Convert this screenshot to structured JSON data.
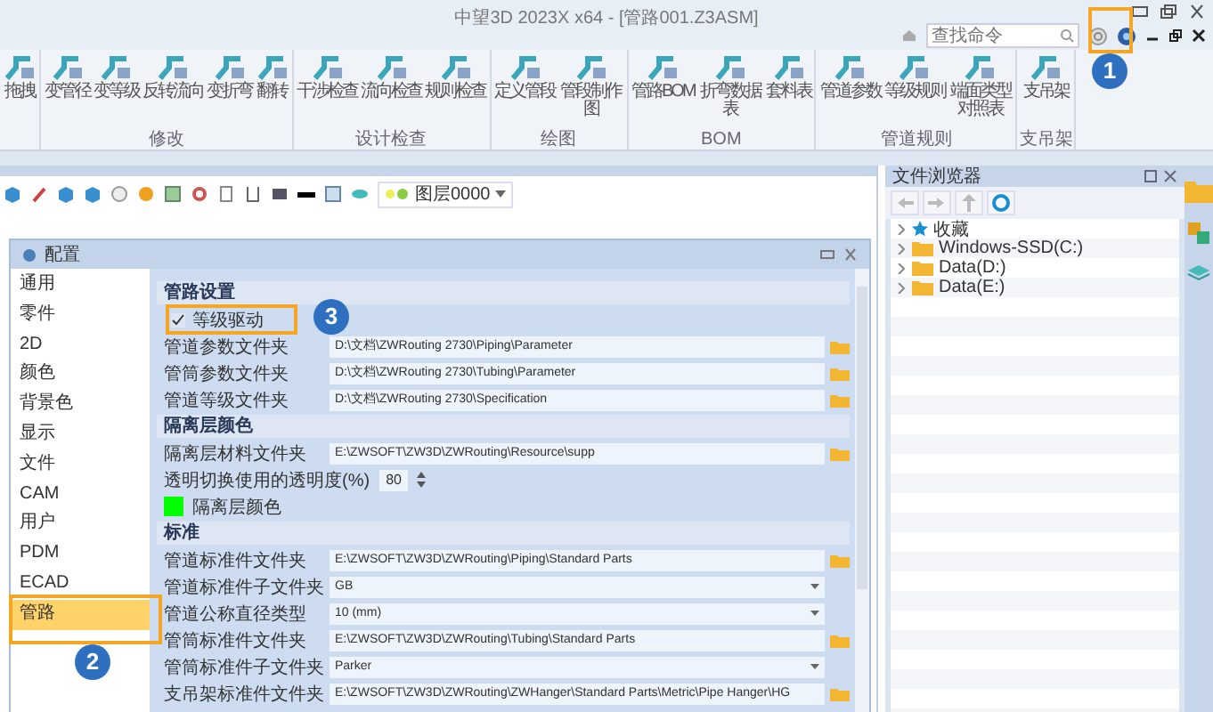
{
  "window": {
    "title": "中望3D 2023X x64 - [管路001.Z3ASM]"
  },
  "search": {
    "placeholder": "查找命令"
  },
  "ribbon": {
    "groups": [
      {
        "buttons": [
          {
            "label": "拖拽"
          }
        ]
      },
      {
        "label": "修改",
        "buttons": [
          {
            "label": "变管径"
          },
          {
            "label": "变等级"
          },
          {
            "label": "反转流向"
          },
          {
            "label": "变折弯"
          },
          {
            "label": "翻转"
          }
        ]
      },
      {
        "label": "设计检查",
        "buttons": [
          {
            "label": "干涉检查"
          },
          {
            "label": "流向检查"
          },
          {
            "label": "规则检查"
          }
        ]
      },
      {
        "label": "绘图",
        "buttons": [
          {
            "label": "定义管段"
          },
          {
            "label": "管段制作图"
          }
        ]
      },
      {
        "label": "BOM",
        "buttons": [
          {
            "label": "管路BOM"
          },
          {
            "label": "折弯数据表"
          },
          {
            "label": "套料表"
          }
        ]
      },
      {
        "label": "管道规则",
        "buttons": [
          {
            "label": "管道参数"
          },
          {
            "label": "等级规则"
          },
          {
            "label": "端面类型对照表"
          }
        ]
      },
      {
        "label": "支吊架",
        "buttons": [
          {
            "label": "支吊架"
          }
        ]
      }
    ]
  },
  "toolbar": {
    "layer": "图层0000"
  },
  "dialog": {
    "title": "配置",
    "categories": [
      {
        "label": "通用",
        "selected": false
      },
      {
        "label": "零件",
        "selected": false
      },
      {
        "label": "2D",
        "selected": false
      },
      {
        "label": "颜色",
        "selected": false
      },
      {
        "label": "背景色",
        "selected": false
      },
      {
        "label": "显示",
        "selected": false
      },
      {
        "label": "文件",
        "selected": false
      },
      {
        "label": "CAM",
        "selected": false
      },
      {
        "label": "用户",
        "selected": false
      },
      {
        "label": "PDM",
        "selected": false
      },
      {
        "label": "ECAD",
        "selected": false
      },
      {
        "label": "管路",
        "selected": true
      }
    ],
    "sections": [
      {
        "title": "管路设置",
        "rows": [
          {
            "kind": "check",
            "label": "等级驱动",
            "checked": true
          },
          {
            "kind": "path",
            "label": "管道参数文件夹",
            "value": "D:\\文档\\ZWRouting 2730\\Piping\\Parameter"
          },
          {
            "kind": "path",
            "label": "管筒参数文件夹",
            "value": "D:\\文档\\ZWRouting 2730\\Tubing\\Parameter"
          },
          {
            "kind": "path",
            "label": "管道等级文件夹",
            "value": "D:\\文档\\ZWRouting 2730\\Specification"
          }
        ]
      },
      {
        "title": "隔离层颜色",
        "rows": [
          {
            "kind": "path",
            "label": "隔离层材料文件夹",
            "value": "E:\\ZWSOFT\\ZW3D\\ZWRouting\\Resource\\supp"
          },
          {
            "kind": "spin",
            "label": "透明切换使用的透明度(%)",
            "value": "80"
          },
          {
            "kind": "color",
            "label": "隔离层颜色",
            "color": "#00ff00"
          }
        ]
      },
      {
        "title": "标准",
        "rows": [
          {
            "kind": "path",
            "label": "管道标准件文件夹",
            "value": "E:\\ZWSOFT\\ZW3D\\ZWRouting\\Piping\\Standard Parts"
          },
          {
            "kind": "select",
            "label": "管道标准件子文件夹",
            "value": "GB"
          },
          {
            "kind": "select",
            "label": "管道公称直径类型",
            "value": "10 (mm)"
          },
          {
            "kind": "path",
            "label": "管筒标准件文件夹",
            "value": "E:\\ZWSOFT\\ZW3D\\ZWRouting\\Tubing\\Standard Parts"
          },
          {
            "kind": "select",
            "label": "管筒标准件子文件夹",
            "value": "Parker"
          },
          {
            "kind": "path",
            "label": "支吊架标准件文件夹",
            "value": "E:\\ZWSOFT\\ZW3D\\ZWRouting\\ZWHanger\\Standard Parts\\Metric\\Pipe Hanger\\HG"
          }
        ]
      }
    ]
  },
  "file_browser": {
    "title": "文件浏览器",
    "tree": [
      {
        "kind": "favorites",
        "label": "收藏",
        "expanded": false
      },
      {
        "kind": "drive",
        "label": "Windows-SSD(C:)",
        "expanded": false
      },
      {
        "kind": "drive",
        "label": "Data(D:)",
        "expanded": false
      },
      {
        "kind": "drive",
        "label": "Data(E:)",
        "expanded": false
      }
    ]
  },
  "callouts": [
    {
      "number": "1"
    },
    {
      "number": "2"
    },
    {
      "number": "3"
    }
  ]
}
